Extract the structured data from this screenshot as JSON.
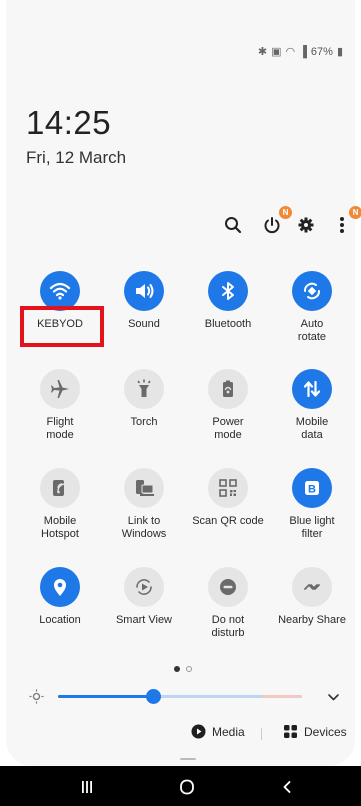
{
  "status_bar": {
    "battery": "67%"
  },
  "clock": {
    "time": "14:25",
    "date": "Fri, 12 March"
  },
  "top_actions": {
    "power_badge": "N",
    "more_badge": "N"
  },
  "tiles": [
    {
      "label": "KEBYOD",
      "state": "on",
      "icon": "wifi-icon"
    },
    {
      "label": "Sound",
      "state": "on",
      "icon": "sound-icon"
    },
    {
      "label": "Bluetooth",
      "state": "on",
      "icon": "bluetooth-icon"
    },
    {
      "label": "Auto\nrotate",
      "state": "on",
      "icon": "auto-rotate-icon"
    },
    {
      "label": "Flight\nmode",
      "state": "off",
      "icon": "airplane-icon"
    },
    {
      "label": "Torch",
      "state": "off",
      "icon": "torch-icon"
    },
    {
      "label": "Power\nmode",
      "state": "off",
      "icon": "power-mode-icon"
    },
    {
      "label": "Mobile\ndata",
      "state": "on",
      "icon": "mobile-data-icon"
    },
    {
      "label": "Mobile\nHotspot",
      "state": "off",
      "icon": "hotspot-icon"
    },
    {
      "label": "Link to\nWindows",
      "state": "off",
      "icon": "link-to-windows-icon"
    },
    {
      "label": "Scan QR code",
      "state": "off",
      "icon": "qr-code-icon"
    },
    {
      "label": "Blue light\nfilter",
      "state": "on",
      "icon": "blue-light-icon"
    },
    {
      "label": "Location",
      "state": "on",
      "icon": "location-icon"
    },
    {
      "label": "Smart View",
      "state": "off",
      "icon": "smart-view-icon"
    },
    {
      "label": "Do not\ndisturb",
      "state": "off",
      "icon": "do-not-disturb-icon"
    },
    {
      "label": "Nearby Share",
      "state": "off",
      "icon": "nearby-share-icon"
    }
  ],
  "pager": {
    "pages": 2,
    "current": 1
  },
  "brightness": {
    "level_percent": 39
  },
  "media_row": {
    "media_label": "Media",
    "devices_label": "Devices"
  },
  "colors": {
    "accent": "#1e78e8",
    "badge": "#f18a36",
    "highlight": "#e4121c"
  }
}
